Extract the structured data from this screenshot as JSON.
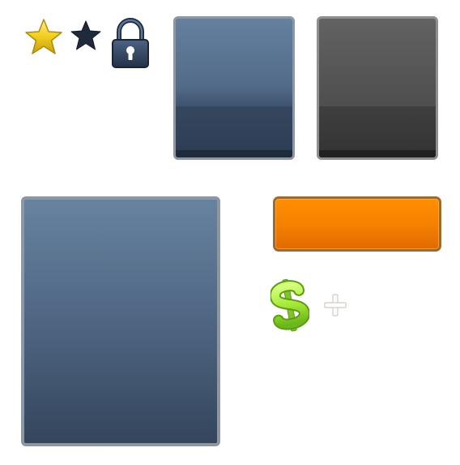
{
  "icons": {
    "star_gold": "star-icon",
    "star_dark": "star-icon",
    "lock": "lock-icon",
    "dollar": "dollar-icon",
    "plus": "plus-icon"
  },
  "colors": {
    "gold": "#f2cf1f",
    "dark_navy": "#1f2b3b",
    "tile_blue": "#5a7596",
    "tile_gray": "#555555",
    "orange": "#ff8a00",
    "dollar_green": "#a6e83a"
  }
}
